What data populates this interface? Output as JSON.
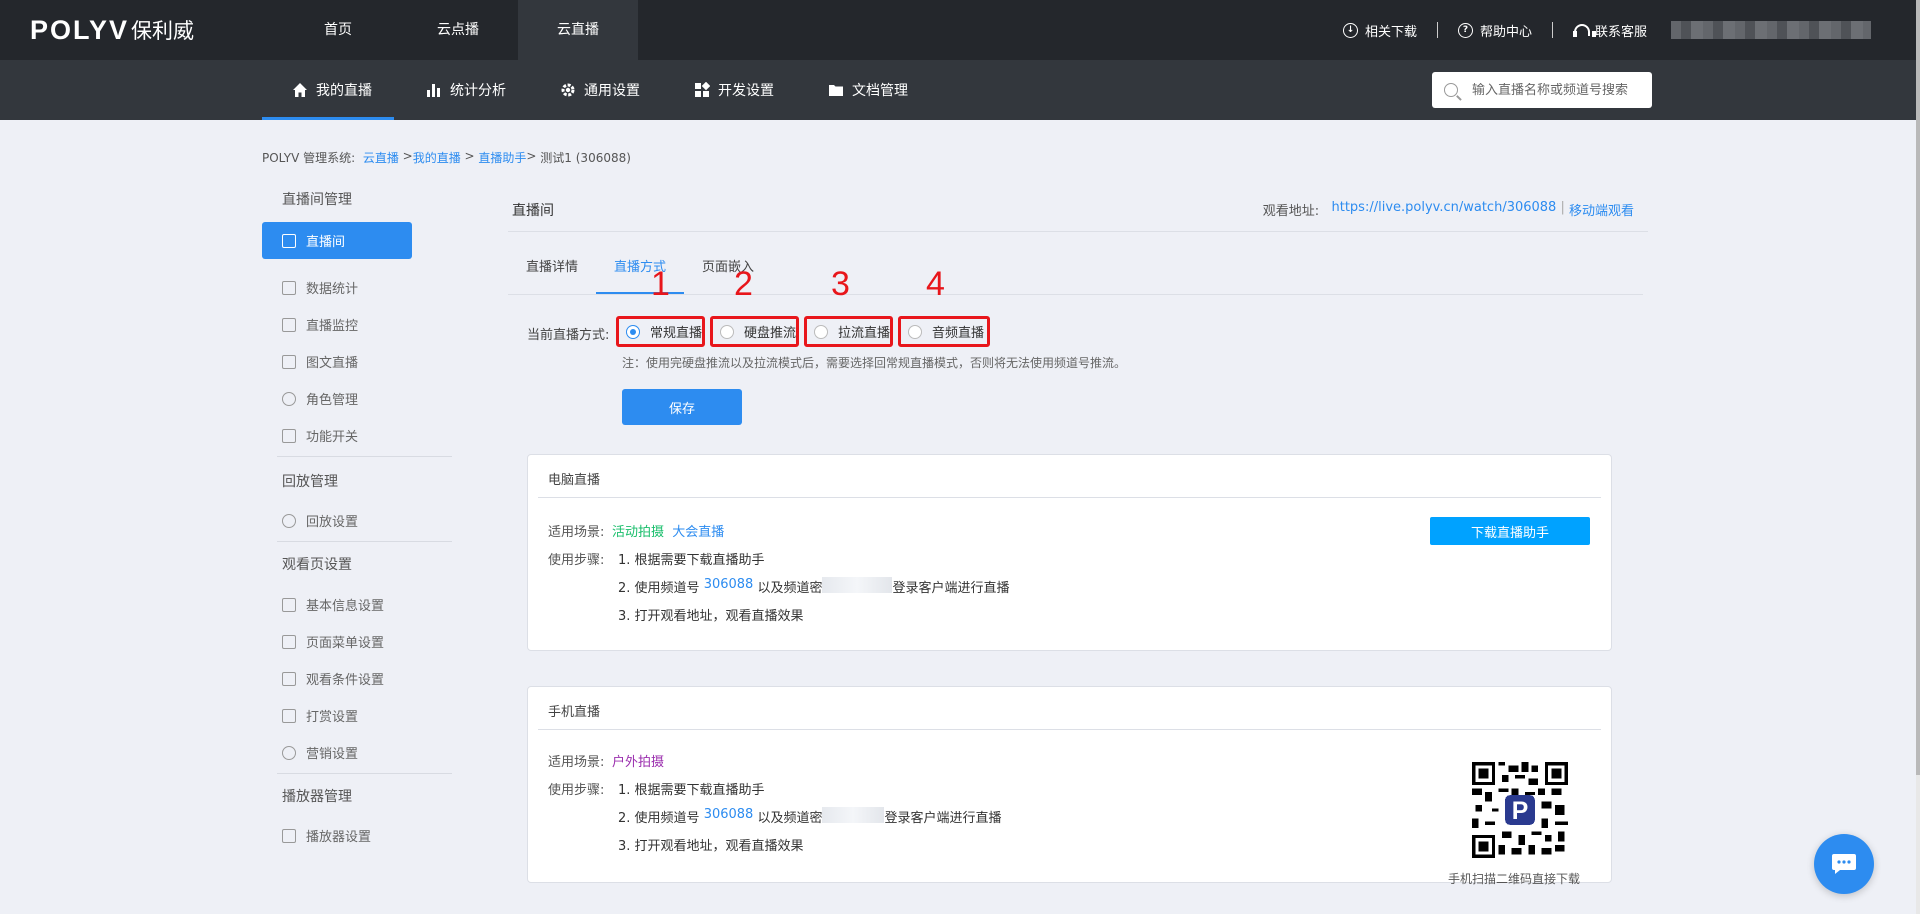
{
  "topbar": {
    "logo_en": "POLYV",
    "logo_cn": "保利威",
    "nav": [
      "首页",
      "云点播",
      "云直播"
    ],
    "active_nav": 2,
    "downloads": "相关下载",
    "help": "帮助中心",
    "support": "联系客服"
  },
  "subnav": {
    "items": [
      {
        "label": "我的直播",
        "icon": "home-icon"
      },
      {
        "label": "统计分析",
        "icon": "bar-chart-icon"
      },
      {
        "label": "通用设置",
        "icon": "gear-icon"
      },
      {
        "label": "开发设置",
        "icon": "grid-icon"
      },
      {
        "label": "文档管理",
        "icon": "folder-icon"
      }
    ],
    "search_placeholder": "输入直播名称或频道号搜索"
  },
  "breadcrumb": {
    "prefix": "POLYV 管理系统:",
    "links": [
      "云直播",
      "我的直播",
      "直播助手"
    ],
    "current": "测试1 (306088)"
  },
  "sidebar": {
    "groups": [
      {
        "title": "直播间管理",
        "items": [
          "直播间",
          "数据统计",
          "直播监控",
          "图文直播",
          "角色管理",
          "功能开关"
        ]
      },
      {
        "title": "回放管理",
        "items": [
          "回放设置"
        ]
      },
      {
        "title": "观看页设置",
        "items": [
          "基本信息设置",
          "页面菜单设置",
          "观看条件设置",
          "打赏设置",
          "营销设置"
        ]
      },
      {
        "title": "播放器管理",
        "items": [
          "播放器设置"
        ]
      }
    ]
  },
  "main": {
    "title": "直播间",
    "watch_label": "观看地址:",
    "watch_url": "https://live.polyv.cn/watch/306088",
    "mobile_link": "移动端观看",
    "tabs": [
      "直播详情",
      "直播方式",
      "页面嵌入"
    ],
    "active_tab": 1,
    "mode_label": "当前直播方式:",
    "modes": [
      "常规直播",
      "硬盘推流",
      "拉流直播",
      "音频直播"
    ],
    "selected_mode": 0,
    "markers": [
      "1",
      "2",
      "3",
      "4"
    ],
    "note": "注：使用完硬盘推流以及拉流模式后，需要选择回常规直播模式，否则将无法使用频道号推流。",
    "save": "保存"
  },
  "pc_card": {
    "title": "电脑直播",
    "scene_label": "适用场景:",
    "scene_1": "活动拍摄",
    "scene_2": "大会直播",
    "steps_label": "使用步骤:",
    "step1": "1. 根据需要下载直播助手",
    "step2_a": "2. 使用频道号",
    "channel": "306088",
    "step2_b": "以及频道密",
    "step2_c": "登录客户端进行直播",
    "step3": "3. 打开观看地址，观看直播效果",
    "download": "下载直播助手"
  },
  "mobile_card": {
    "title": "手机直播",
    "scene_label": "适用场景:",
    "scene_1": "户外拍摄",
    "steps_label": "使用步骤:",
    "step1": "1. 根据需要下载直播助手",
    "step2_a": "2. 使用频道号",
    "channel": "306088",
    "step2_b": "以及频道密",
    "step2_c": "登录客户端进行直播",
    "step3": "3. 打开观看地址，观看直播效果",
    "qr_caption": "手机扫描二维码直接下载"
  },
  "colors": {
    "accent": "#2d8cf0",
    "highlight": "#e8161b",
    "topbar": "#24272c"
  }
}
